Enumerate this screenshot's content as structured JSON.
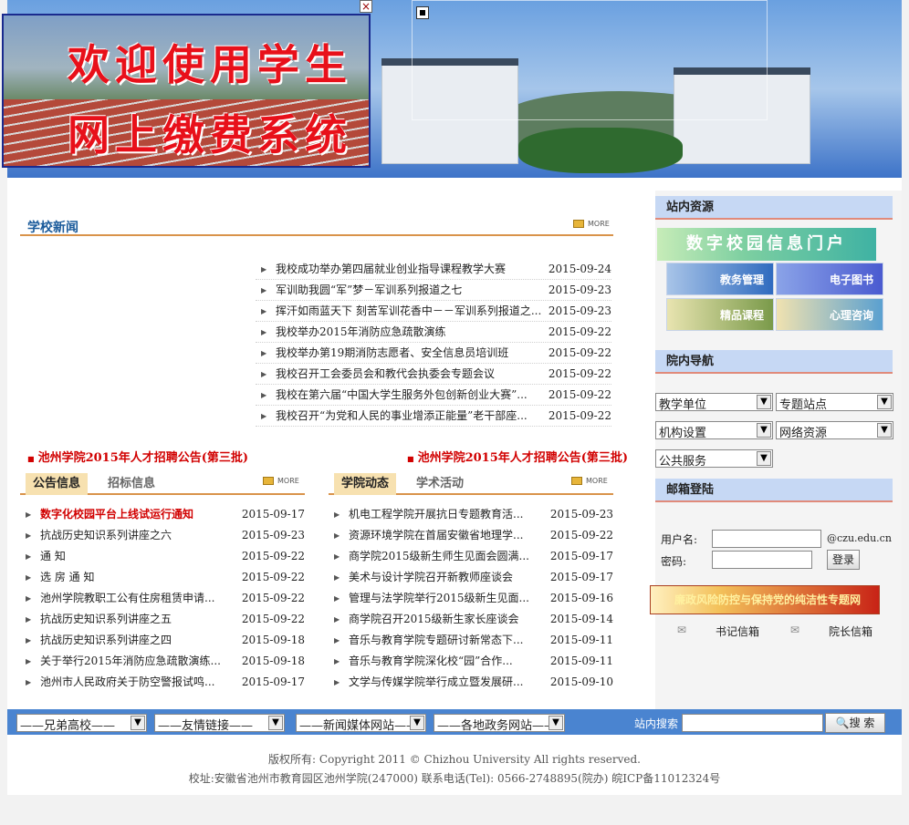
{
  "banner": {
    "popup_line1": "欢迎使用学生",
    "popup_line2": "网上缴费系统",
    "close_label": "×"
  },
  "school_news": {
    "title": "学校新闻",
    "more": "MORE",
    "items": [
      {
        "text": "我校成功举办第四届就业创业指导课程教学大赛",
        "date": "2015-09-24"
      },
      {
        "text": "军训助我圆“军”梦－军训系列报道之七",
        "date": "2015-09-23"
      },
      {
        "text": "挥汗如雨蓝天下  刻苦军训花香中－－军训系列报道之...",
        "date": "2015-09-23"
      },
      {
        "text": "我校举办2015年消防应急疏散演练",
        "date": "2015-09-22"
      },
      {
        "text": "我校举办第19期消防志愿者、安全信息员培训班",
        "date": "2015-09-22"
      },
      {
        "text": "我校召开工会委员会和教代会执委会专题会议",
        "date": "2015-09-22"
      },
      {
        "text": "我校在第六届“中国大学生服务外包创新创业大赛”...",
        "date": "2015-09-22"
      },
      {
        "text": "我校召开“为党和人民的事业增添正能量”老干部座...",
        "date": "2015-09-22"
      }
    ]
  },
  "recruit": {
    "left": "池州学院2015年人才招聘公告(第三批)",
    "right": "池州学院2015年人才招聘公告(第三批)"
  },
  "notice": {
    "tabs": [
      "公告信息",
      "招标信息"
    ],
    "more": "MORE",
    "items": [
      {
        "text": "数字化校园平台上线试运行通知",
        "date": "2015-09-17",
        "highlight": true
      },
      {
        "text": "抗战历史知识系列讲座之六",
        "date": "2015-09-23"
      },
      {
        "text": "通    知",
        "date": "2015-09-22"
      },
      {
        "text": "选 房 通 知",
        "date": "2015-09-22"
      },
      {
        "text": "池州学院教职工公有住房租赁申请...",
        "date": "2015-09-22"
      },
      {
        "text": "抗战历史知识系列讲座之五",
        "date": "2015-09-22"
      },
      {
        "text": "抗战历史知识系列讲座之四",
        "date": "2015-09-18"
      },
      {
        "text": "关于举行2015年消防应急疏散演练...",
        "date": "2015-09-18"
      },
      {
        "text": "池州市人民政府关于防空警报试鸣...",
        "date": "2015-09-17"
      }
    ]
  },
  "college": {
    "tabs": [
      "学院动态",
      "学术活动"
    ],
    "more": "MORE",
    "items": [
      {
        "text": "机电工程学院开展抗日专题教育活...",
        "date": "2015-09-23"
      },
      {
        "text": "资源环境学院在首届安徽省地理学...",
        "date": "2015-09-22"
      },
      {
        "text": "商学院2015级新生师生见面会圆满...",
        "date": "2015-09-17"
      },
      {
        "text": "美术与设计学院召开新教师座谈会",
        "date": "2015-09-17"
      },
      {
        "text": "管理与法学院举行2015级新生见面...",
        "date": "2015-09-16"
      },
      {
        "text": "商学院召开2015级新生家长座谈会",
        "date": "2015-09-14"
      },
      {
        "text": "音乐与教育学院专题研讨新常态下...",
        "date": "2015-09-11"
      },
      {
        "text": "音乐与教育学院深化校“园”合作...",
        "date": "2015-09-11"
      },
      {
        "text": "文学与传媒学院举行成立暨发展研...",
        "date": "2015-09-10"
      }
    ]
  },
  "sidebar": {
    "resources_title": "站内资源",
    "portal": "数字校园信息门户",
    "tiles": [
      "教务管理",
      "电子图书",
      "精品课程",
      "心理咨询"
    ],
    "nav_title": "院内导航",
    "nav_selects": [
      "教学单位",
      "专题站点",
      "机构设置",
      "网络资源",
      "公共服务"
    ],
    "mail_title": "邮箱登陆",
    "username_label": "用户名:",
    "password_label": "密码:",
    "domain": "@czu.edu.cn",
    "login": "登录",
    "lianzheng": "廉政风险防控与保持党的纯洁性专题网",
    "mail_links": [
      "书记信箱",
      "院长信箱"
    ]
  },
  "bottom": {
    "selects": [
      "——兄弟高校——",
      "——友情链接——",
      "——新闻媒体网站——",
      "——各地政务网站——"
    ],
    "search_label": "站内搜索",
    "search_btn": "搜 索"
  },
  "footer": {
    "line1": "版权所有: Copyright 2011 © Chizhou University All rights reserved.",
    "line2": "校址:安徽省池州市教育园区池州学院(247000) 联系电话(Tel): 0566-2748895(院办) 皖ICP备11012324号"
  },
  "colors": {
    "accent_blue": "#1b5b9b",
    "red": "#d10000",
    "header_bg": "#c6d8f4",
    "orange_line": "#d9934a"
  }
}
